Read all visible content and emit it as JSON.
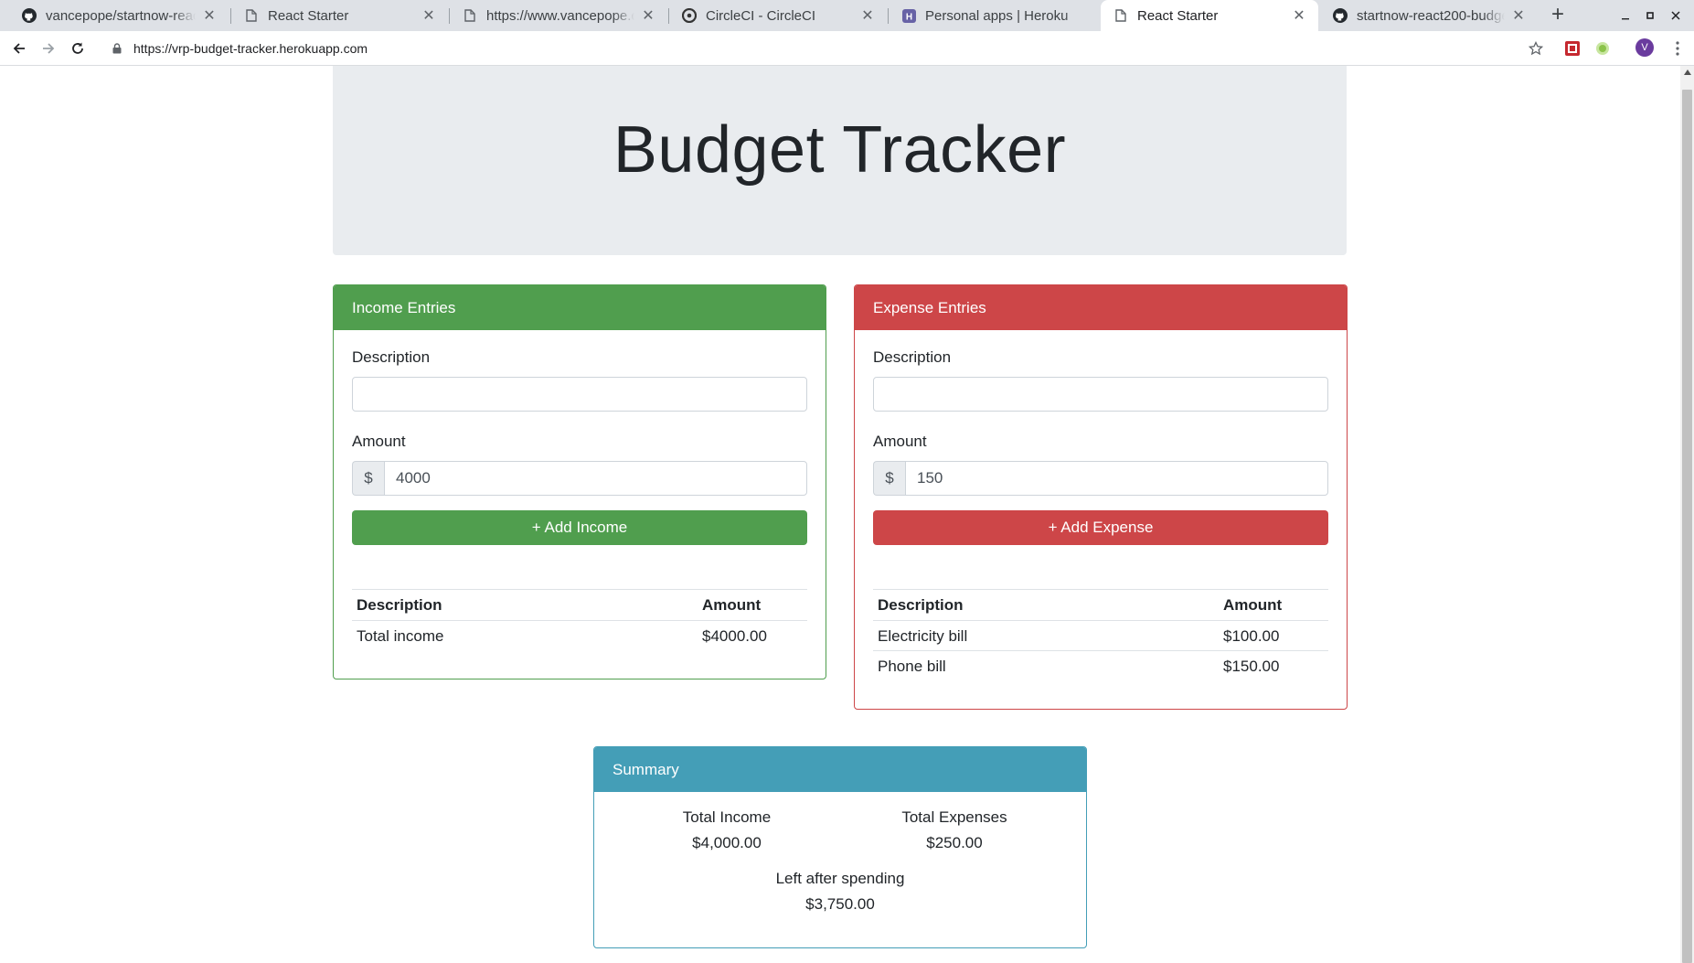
{
  "browser": {
    "tabs": [
      {
        "title": "vancepope/startnow-react200-budget-tracker",
        "icon": "github-icon",
        "active": false
      },
      {
        "title": "React Starter",
        "icon": "page-icon",
        "active": false
      },
      {
        "title": "https://www.vancepope.com",
        "icon": "page-icon",
        "active": false
      },
      {
        "title": "CircleCI - CircleCI",
        "icon": "circleci-icon",
        "active": false
      },
      {
        "title": "Personal apps | Heroku",
        "icon": "heroku-icon",
        "active": false
      },
      {
        "title": "React Starter",
        "icon": "page-icon",
        "active": true
      },
      {
        "title": "startnow-react200-budget-tracker",
        "icon": "github-icon",
        "active": false
      }
    ],
    "url": "https://vrp-budget-tracker.herokuapp.com",
    "profile_initial": "V"
  },
  "page": {
    "title": "Budget Tracker",
    "income": {
      "header": "Income Entries",
      "description_label": "Description",
      "description_value": "",
      "amount_label": "Amount",
      "currency_prefix": "$",
      "amount_value": "4000",
      "button_label": "+ Add Income",
      "table": {
        "headers": [
          "Description",
          "Amount"
        ],
        "rows": [
          {
            "description": "Total income",
            "amount": "$4000.00"
          }
        ]
      }
    },
    "expense": {
      "header": "Expense Entries",
      "description_label": "Description",
      "description_value": "",
      "amount_label": "Amount",
      "currency_prefix": "$",
      "amount_value": "150",
      "button_label": "+ Add Expense",
      "table": {
        "headers": [
          "Description",
          "Amount"
        ],
        "rows": [
          {
            "description": "Electricity bill",
            "amount": "$100.00"
          },
          {
            "description": "Phone bill",
            "amount": "$150.00"
          }
        ]
      }
    },
    "summary": {
      "header": "Summary",
      "total_income_label": "Total Income",
      "total_income_value": "$4,000.00",
      "total_expenses_label": "Total Expenses",
      "total_expenses_value": "$250.00",
      "left_label": "Left after spending",
      "left_value": "$3,750.00"
    }
  },
  "colors": {
    "income": "#509e4e",
    "expense": "#cd4648",
    "summary": "#449eb7",
    "jumbotron": "#e9ecef"
  }
}
